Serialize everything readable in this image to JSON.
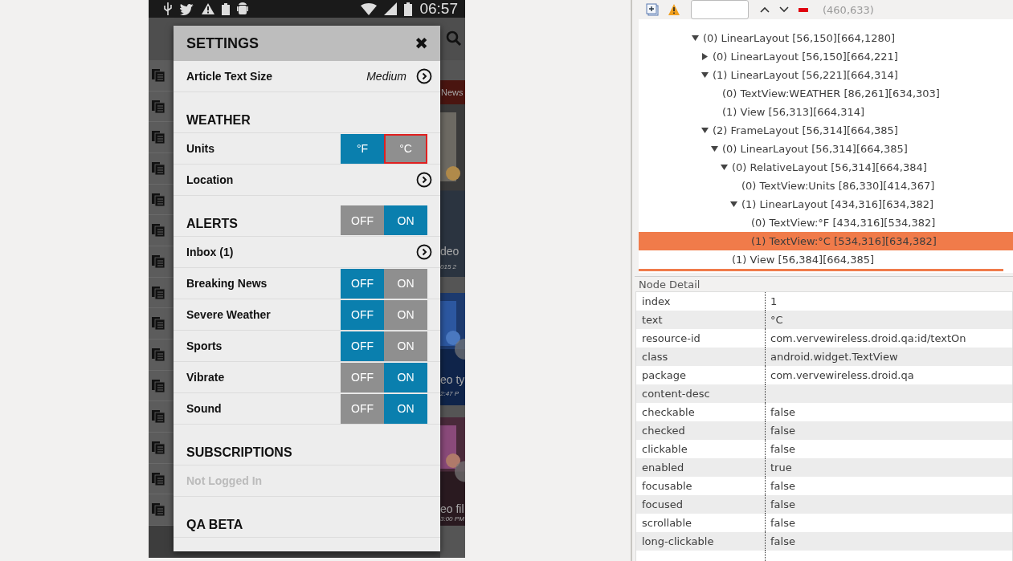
{
  "phone": {
    "status_bar": {
      "time": "06:57"
    },
    "background": {
      "captions": [
        {
          "kind": "banner",
          "text": "News"
        },
        {
          "kind": "title",
          "text": "deo"
        },
        {
          "kind": "date",
          "text": "015 2"
        },
        {
          "kind": "title",
          "text": "eo ty"
        },
        {
          "kind": "date",
          "text": "2:47 P"
        },
        {
          "kind": "title",
          "text": "eo fil"
        },
        {
          "kind": "date",
          "text": "3:00 PM"
        }
      ]
    },
    "settings": {
      "title": "SETTINGS",
      "close": "✖",
      "rows": [
        {
          "kind": "value",
          "label": "Article Text Size",
          "value": "Medium"
        },
        {
          "kind": "section",
          "label": "WEATHER"
        },
        {
          "kind": "toggle",
          "label": "Units",
          "options": [
            {
              "label": "°F",
              "selected": true,
              "highlighted": false
            },
            {
              "label": "°C",
              "selected": false,
              "highlighted": true
            }
          ]
        },
        {
          "kind": "link",
          "label": "Location"
        },
        {
          "kind": "section",
          "label": "ALERTS",
          "options": [
            {
              "label": "OFF",
              "selected": false,
              "highlighted": false
            },
            {
              "label": "ON",
              "selected": true,
              "highlighted": false
            }
          ]
        },
        {
          "kind": "link",
          "label": "Inbox (1)"
        },
        {
          "kind": "toggle",
          "label": "Breaking News",
          "options": [
            {
              "label": "OFF",
              "selected": true,
              "highlighted": false
            },
            {
              "label": "ON",
              "selected": false,
              "highlighted": false
            }
          ]
        },
        {
          "kind": "toggle",
          "label": "Severe Weather",
          "options": [
            {
              "label": "OFF",
              "selected": true,
              "highlighted": false
            },
            {
              "label": "ON",
              "selected": false,
              "highlighted": false
            }
          ]
        },
        {
          "kind": "toggle",
          "label": "Sports",
          "options": [
            {
              "label": "OFF",
              "selected": true,
              "highlighted": false
            },
            {
              "label": "ON",
              "selected": false,
              "highlighted": false
            }
          ]
        },
        {
          "kind": "toggle",
          "label": "Vibrate",
          "options": [
            {
              "label": "OFF",
              "selected": false,
              "highlighted": false
            },
            {
              "label": "ON",
              "selected": true,
              "highlighted": false
            }
          ]
        },
        {
          "kind": "toggle",
          "label": "Sound",
          "options": [
            {
              "label": "OFF",
              "selected": false,
              "highlighted": false
            },
            {
              "label": "ON",
              "selected": true,
              "highlighted": false
            }
          ]
        },
        {
          "kind": "section",
          "label": "SUBSCRIPTIONS"
        },
        {
          "kind": "text",
          "label": "Not Logged In",
          "disabled": true
        },
        {
          "kind": "section",
          "label": "QA BETA"
        }
      ]
    }
  },
  "toolbar": {
    "coordinates": "(460,633)"
  },
  "tree": {
    "nodes": [
      {
        "label": "(0) LinearLayout [56,150][664,1280]",
        "expanded": true,
        "selected": false,
        "children": [
          {
            "label": "(0) LinearLayout [56,150][664,221]",
            "expanded": false,
            "selected": false
          },
          {
            "label": "(1) LinearLayout [56,221][664,314]",
            "expanded": true,
            "selected": false,
            "children": [
              {
                "label": "(0) TextView:WEATHER [86,261][634,303]",
                "selected": false
              },
              {
                "label": "(1) View [56,313][664,314]",
                "selected": false
              }
            ]
          },
          {
            "label": "(2) FrameLayout [56,314][664,385]",
            "expanded": true,
            "selected": false,
            "children": [
              {
                "label": "(0) LinearLayout [56,314][664,385]",
                "expanded": true,
                "selected": false,
                "children": [
                  {
                    "label": "(0) RelativeLayout [56,314][664,384]",
                    "expanded": true,
                    "selected": false,
                    "children": [
                      {
                        "label": "(0) TextView:Units [86,330][414,367]",
                        "selected": false
                      },
                      {
                        "label": "(1) LinearLayout [434,316][634,382]",
                        "expanded": true,
                        "selected": false,
                        "children": [
                          {
                            "label": "(0) TextView:°F [434,316][534,382]",
                            "selected": false
                          },
                          {
                            "label": "(1) TextView:°C [534,316][634,382]",
                            "selected": true
                          }
                        ]
                      }
                    ]
                  },
                  {
                    "label": "(1) View [56,384][664,385]",
                    "selected": false
                  }
                ]
              }
            ]
          }
        ]
      }
    ]
  },
  "node_detail": {
    "title": "Node Detail",
    "rows": [
      {
        "key": "index",
        "value": "1"
      },
      {
        "key": "text",
        "value": "°C"
      },
      {
        "key": "resource-id",
        "value": "com.vervewireless.droid.qa:id/textOn"
      },
      {
        "key": "class",
        "value": "android.widget.TextView"
      },
      {
        "key": "package",
        "value": "com.vervewireless.droid.qa"
      },
      {
        "key": "content-desc"
      },
      {
        "key": "checkable",
        "value": "false"
      },
      {
        "key": "checked",
        "value": "false"
      },
      {
        "key": "clickable",
        "value": "false"
      },
      {
        "key": "enabled",
        "value": "true"
      },
      {
        "key": "focusable",
        "value": "false"
      },
      {
        "key": "focused",
        "value": "false"
      },
      {
        "key": "scrollable",
        "value": "false"
      },
      {
        "key": "long-clickable",
        "value": "false"
      }
    ]
  }
}
